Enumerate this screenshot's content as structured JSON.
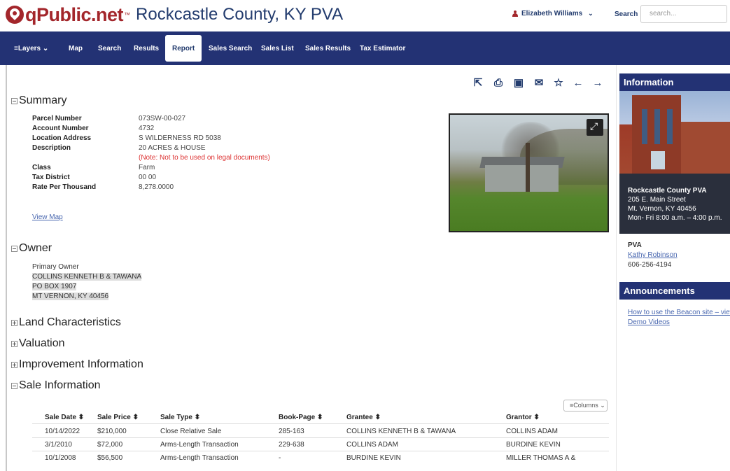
{
  "header": {
    "brand": "qPublic.net",
    "brand_tm": "™",
    "county_title": "Rockcastle County, KY PVA",
    "user_name": "Elizabeth Williams",
    "search_label": "Search",
    "search_placeholder": "search..."
  },
  "nav": {
    "items": [
      "≡Layers ⌄",
      "Map",
      "Search",
      "Results",
      "Report",
      "Sales Search",
      "Sales List",
      "Sales Results",
      "Tax Estimator"
    ],
    "active": "Report"
  },
  "toolbar": {
    "icons": [
      "share-icon",
      "print-icon",
      "image-icon",
      "email-icon",
      "star-icon",
      "arrow-left-icon",
      "arrow-right-icon"
    ]
  },
  "summary": {
    "title": "Summary",
    "fields": [
      {
        "label": "Parcel Number",
        "value": "073SW-00-027"
      },
      {
        "label": "Account Number",
        "value": "4732"
      },
      {
        "label": "Location Address",
        "value": "S WILDERNESS RD 5038"
      },
      {
        "label": "Description",
        "value": "20 ACRES & HOUSE"
      },
      {
        "label": "Class",
        "value": "Farm"
      },
      {
        "label": "Tax District",
        "value": "00 00"
      },
      {
        "label": "Rate Per Thousand",
        "value": "8,278.0000"
      }
    ],
    "description_note": "(Note: Not to be used on legal documents)",
    "view_map": "View Map"
  },
  "owner": {
    "title": "Owner",
    "primary_label": "Primary Owner",
    "lines": [
      "COLLINS KENNETH B & TAWANA",
      "PO BOX 1907",
      "MT VERNON, KY 40456"
    ]
  },
  "collapsed_sections": [
    "Land Characteristics",
    "Valuation",
    "Improvement Information"
  ],
  "sales": {
    "title": "Sale Information",
    "columns_button": "≡Columns ⌄",
    "headers": [
      "Sale Date ⬍",
      "Sale Price ⬍",
      "Sale Type ⬍",
      "Book-Page ⬍",
      "Grantee ⬍",
      "Grantor ⬍"
    ],
    "rows": [
      [
        "10/14/2022",
        "$210,000",
        "Close Relative Sale",
        "285-163",
        "COLLINS KENNETH B & TAWANA",
        "COLLINS ADAM"
      ],
      [
        "3/1/2010",
        "$72,000",
        "Arms-Length Transaction",
        "229-638",
        "COLLINS ADAM",
        "BURDINE KEVIN"
      ],
      [
        "10/1/2008",
        "$56,500",
        "Arms-Length Transaction",
        "-",
        "BURDINE KEVIN",
        "MILLER THOMAS A &"
      ]
    ]
  },
  "sidebar": {
    "info_title": "Information",
    "office_name": "Rockcastle County PVA",
    "address1": "205 E. Main Street",
    "address2": "Mt. Vernon, KY 40456",
    "hours": "Mon- Fri 8:00 a.m. – 4:00 p.m.",
    "pva_label": "PVA",
    "pva_name": "Kathy Robinson",
    "pva_phone": "606-256-4194",
    "announcements_title": "Announcements",
    "announcement_link1": "How to use the Beacon site – view",
    "announcement_link2": "Demo Videos"
  },
  "colors": {
    "brand_red": "#a3262b",
    "nav_blue": "#233274",
    "title_blue": "#233c6e",
    "link_blue": "#4a68b0",
    "note_red": "#d33333"
  }
}
